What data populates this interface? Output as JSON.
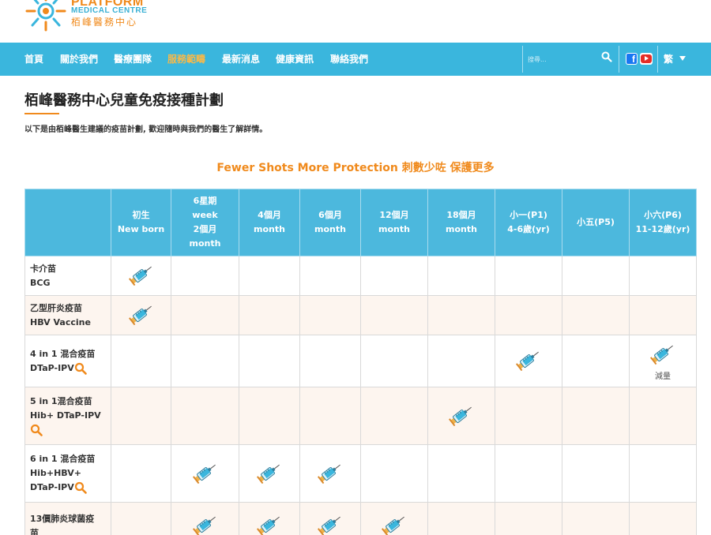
{
  "colors": {
    "brand_orange": "#f08a1c",
    "brand_blue": "#3ab6dd",
    "nav_active": "#f6b94a",
    "row_alt": "#fdf5ef"
  },
  "logo": {
    "title": "PLATFORM",
    "subtitle": "MEDICAL CENTRE",
    "chinese": "栢峰醫務中心"
  },
  "nav": {
    "items": [
      {
        "label": "首頁",
        "active": false
      },
      {
        "label": "關於我們",
        "active": false
      },
      {
        "label": "醫療團隊",
        "active": false
      },
      {
        "label": "服務範疇",
        "active": true
      },
      {
        "label": "最新消息",
        "active": false
      },
      {
        "label": "健康資訊",
        "active": false
      },
      {
        "label": "聯絡我們",
        "active": false
      }
    ],
    "search_placeholder": "搜尋...",
    "search_icon": "search-icon",
    "social": [
      "facebook-icon",
      "youtube-icon"
    ],
    "language": "繁"
  },
  "page": {
    "title": "栢峰醫務中心兒童免疫接種計劃",
    "intro": "以下是由栢峰醫生建議的疫苗計劃, 歡迎隨時與我們的醫生了解詳情。",
    "subtitle": "Fewer Shots More Protection 刺數少咗  保護更多"
  },
  "table": {
    "columns": [
      "",
      "初生\nNew born",
      "6星期\nweek\n2個月\nmonth",
      "4個月\nmonth",
      "6個月\nmonth",
      "12個月\nmonth",
      "18個月\nmonth",
      "小一(P1)\n4-6歲(yr)",
      "小五(P5)",
      "小六(P6)\n11-12歲(yr)"
    ],
    "rows": [
      {
        "name": [
          "卡介苗",
          "BCG"
        ],
        "info": false,
        "doses": [
          1,
          0,
          0,
          0,
          0,
          0,
          0,
          0,
          0
        ],
        "notes": {}
      },
      {
        "name": [
          "乙型肝炎疫苗",
          "HBV Vaccine"
        ],
        "info": false,
        "doses": [
          1,
          0,
          0,
          0,
          0,
          0,
          0,
          0,
          0
        ],
        "notes": {}
      },
      {
        "name": [
          "4 in 1 混合疫苗",
          "DTaP-IPV"
        ],
        "info": "inline",
        "doses": [
          0,
          0,
          0,
          0,
          0,
          0,
          1,
          0,
          1
        ],
        "notes": {
          "8": "減量"
        }
      },
      {
        "name": [
          "5 in 1混合疫苗",
          "Hib+ DTaP-IPV"
        ],
        "info": "newline",
        "doses": [
          0,
          0,
          0,
          0,
          0,
          1,
          0,
          0,
          0
        ],
        "notes": {}
      },
      {
        "name": [
          "6 in 1 混合疫苗",
          "Hib+HBV+",
          "DTaP-IPV"
        ],
        "info": "inline",
        "doses": [
          0,
          1,
          1,
          1,
          0,
          0,
          0,
          0,
          0
        ],
        "notes": {}
      },
      {
        "name": [
          "13價肺炎球菌疫",
          "苗"
        ],
        "info": false,
        "doses": [
          0,
          1,
          1,
          1,
          1,
          0,
          0,
          0,
          0
        ],
        "notes": {}
      }
    ]
  }
}
